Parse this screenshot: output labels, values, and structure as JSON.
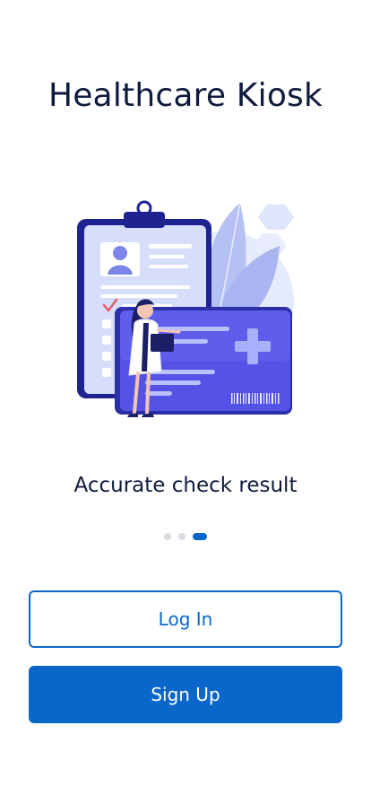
{
  "app": {
    "title": "Healthcare Kiosk"
  },
  "onboarding": {
    "caption": "Accurate check result",
    "total_slides": 3,
    "active_slide": 3
  },
  "buttons": {
    "login_label": "Log In",
    "signup_label": "Sign Up"
  },
  "illustration": {
    "icon": "doctor-with-medical-card-illustration"
  },
  "colors": {
    "primary": "#0a67c9",
    "title_text": "#0f1b3d",
    "dot_inactive": "#d9dbe3",
    "illustration_purple": "#4a44d6",
    "illustration_lavender": "#c9d2f8"
  }
}
